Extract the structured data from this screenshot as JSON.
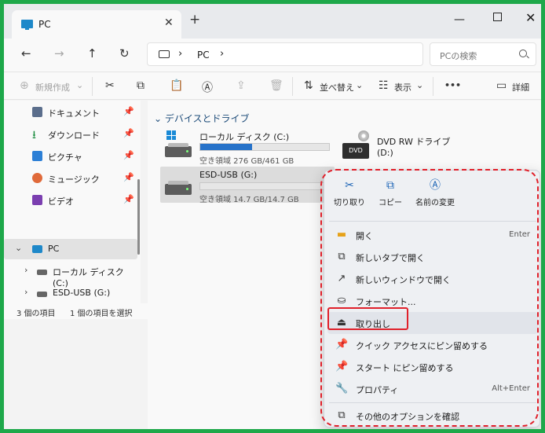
{
  "window": {
    "tab_title": "PC",
    "close_tab": "✕",
    "new_tab": "+",
    "minimize": "—",
    "close": "✕"
  },
  "nav": {
    "back": "←",
    "forward": "→",
    "up": "↑",
    "refresh": "↻",
    "breadcrumb": [
      "PC"
    ],
    "chevron": "›",
    "search_placeholder": "PCの検索"
  },
  "toolbar": {
    "new_label": "新規作成",
    "sort_label": "並べ替え",
    "view_label": "表示",
    "more_label": "•••",
    "details_label": "詳細"
  },
  "sidebar": {
    "items": [
      {
        "label": "ドキュメント",
        "icon": "document-icon",
        "pinned": true
      },
      {
        "label": "ダウンロード",
        "icon": "download-icon",
        "pinned": true
      },
      {
        "label": "ピクチャ",
        "icon": "pictures-icon",
        "pinned": true
      },
      {
        "label": "ミュージック",
        "icon": "music-icon",
        "pinned": true
      },
      {
        "label": "ビデオ",
        "icon": "video-icon",
        "pinned": true
      },
      {
        "label": "PC",
        "icon": "pc-icon",
        "selected": true
      },
      {
        "label": "ローカル ディスク (C:)",
        "icon": "local-disk-icon"
      },
      {
        "label": "ESD-USB (G:)",
        "icon": "usb-drive-icon"
      }
    ]
  },
  "status": {
    "count": "3 個の項目",
    "selected": "1 個の項目を選択"
  },
  "main": {
    "group_title": "デバイスとドライブ",
    "drives": [
      {
        "name": "ローカル ディスク (C:)",
        "space": "空き領域 276 GB/461 GB",
        "used_fraction": 0.4
      },
      {
        "name": "ESD-USB (G:)",
        "space": "空き領域 14.7 GB/14.7 GB",
        "used_fraction": 0.0,
        "selected": true
      },
      {
        "name": "DVD RW ドライブ (D:)",
        "dvd_label": "DVD"
      }
    ]
  },
  "context_menu": {
    "quick": [
      {
        "label": "切り取り",
        "icon": "scissors-icon"
      },
      {
        "label": "コピー",
        "icon": "copy-icon"
      },
      {
        "label": "名前の変更",
        "icon": "rename-icon"
      }
    ],
    "items": [
      {
        "label": "開く",
        "shortcut": "Enter",
        "icon": "folder-icon"
      },
      {
        "label": "新しいタブで開く",
        "shortcut": "",
        "icon": "new-tab-icon"
      },
      {
        "label": "新しいウィンドウで開く",
        "shortcut": "",
        "icon": "new-window-icon"
      },
      {
        "label": "フォーマット...",
        "shortcut": "",
        "icon": "format-icon"
      },
      {
        "label": "取り出し",
        "shortcut": "",
        "icon": "eject-icon"
      },
      {
        "label": "クイック アクセスにピン留めする",
        "shortcut": "",
        "icon": "pin-icon"
      },
      {
        "label": "スタート にピン留めする",
        "shortcut": "",
        "icon": "pin-icon"
      },
      {
        "label": "プロパティ",
        "shortcut": "Alt+Enter",
        "icon": "wrench-icon"
      },
      {
        "label": "その他のオプションを確認",
        "shortcut": "",
        "icon": "more-options-icon"
      }
    ]
  },
  "colors": {
    "frame_border": "#1ea84a",
    "annotation": "#e0202a",
    "accent": "#1a62b5",
    "drive_fill": "#2672c9"
  }
}
